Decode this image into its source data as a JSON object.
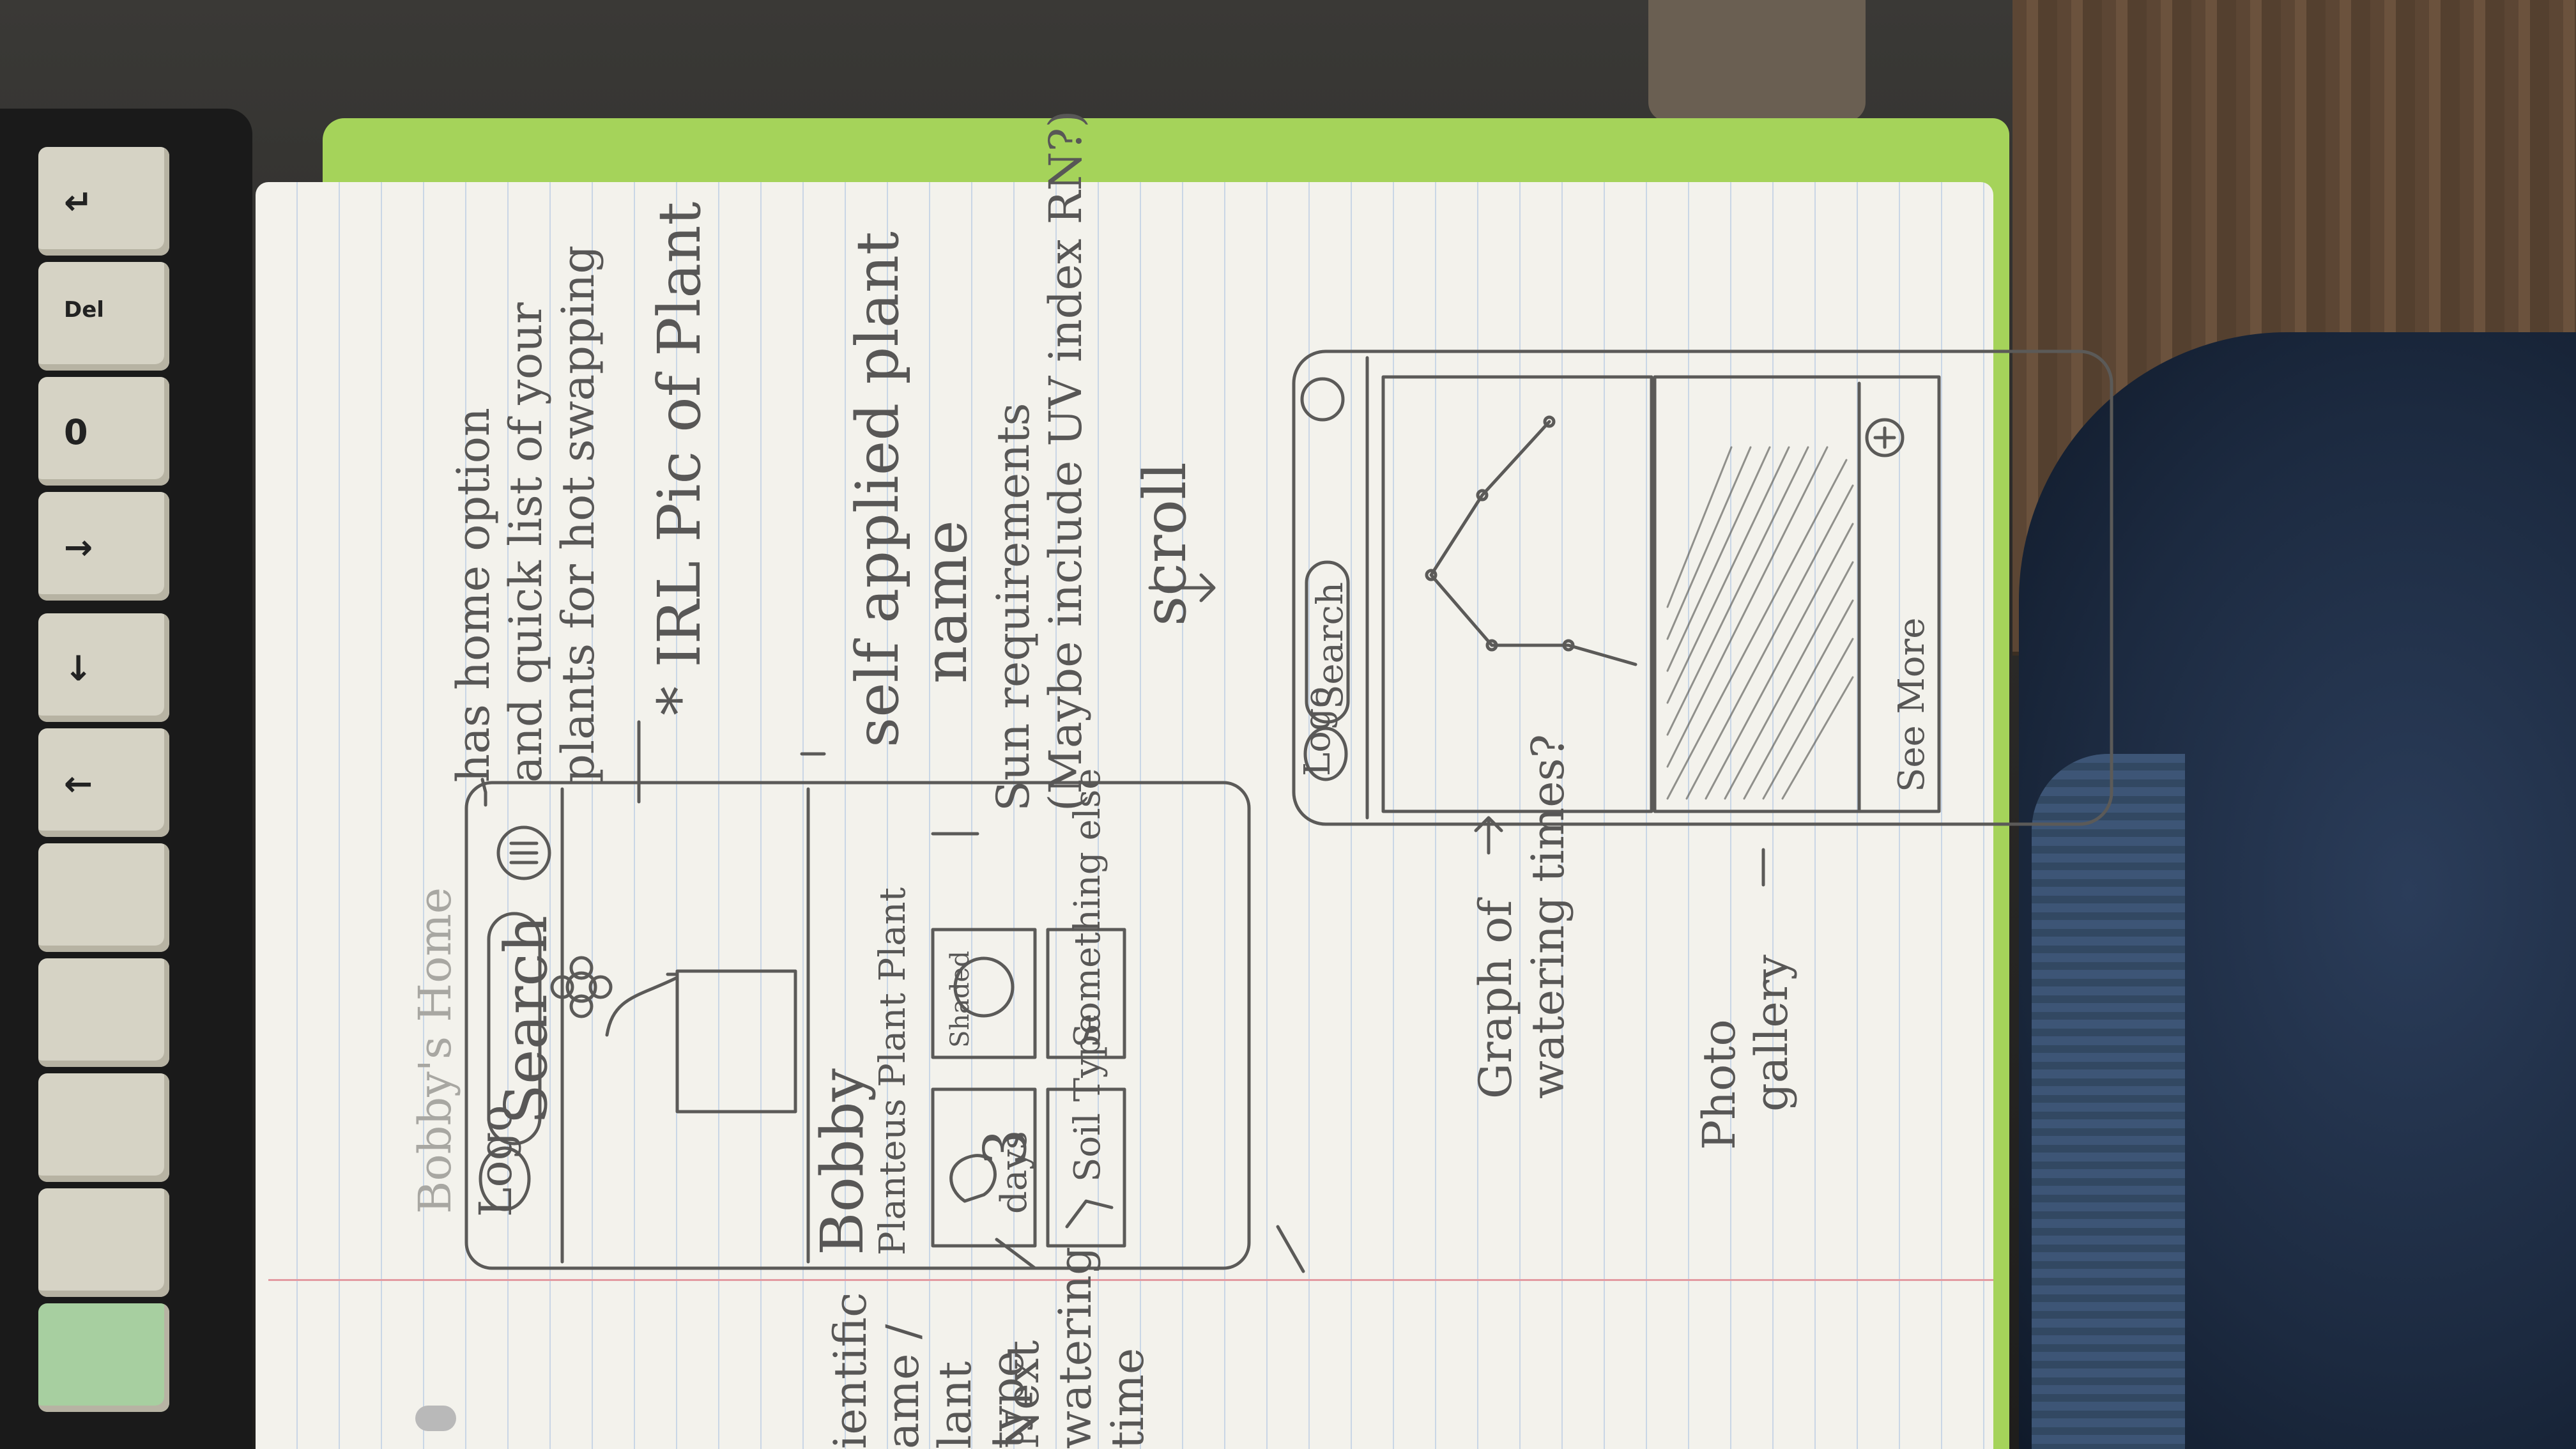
{
  "phone_mockup_home": {
    "logo": "Logo",
    "search": "Search",
    "menu_icon": "hamburger-menu-icon",
    "plant_name": "Bobby",
    "scientific_name": "Planteus Plant Plant",
    "tiles": {
      "watering": {
        "value": "3",
        "unit": "days"
      },
      "sun": "Shaded",
      "soil": "Soil Type",
      "other": "Something else"
    }
  },
  "phone_mockup_detail": {
    "logo": "Logo",
    "search": "Search",
    "menu_icon": "hamburger-menu-icon",
    "see_more": "See More",
    "add_icon": "plus-icon"
  },
  "annotations": {
    "home_option": [
      "has home option",
      "and quick list of your",
      "plants for hot swapping"
    ],
    "irl_pic": "* IRL Pic of Plant",
    "self_applied_name": [
      "self applied plant",
      "name"
    ],
    "sun_requirements": [
      "Sun requirements",
      "(Maybe include UV index RN?)"
    ],
    "scroll": "scroll",
    "scientific_name_note": [
      "ientific",
      "ame /",
      "lant",
      "type"
    ],
    "next_watering": [
      "Next",
      "watering",
      "time"
    ],
    "graph_note": [
      "Graph of",
      "watering times?"
    ],
    "photo_gallery": [
      "Photo",
      "gallery"
    ],
    "faint_title": "Bobby's Home"
  },
  "keyboard": {
    "keys": [
      "Del",
      "0"
    ]
  }
}
